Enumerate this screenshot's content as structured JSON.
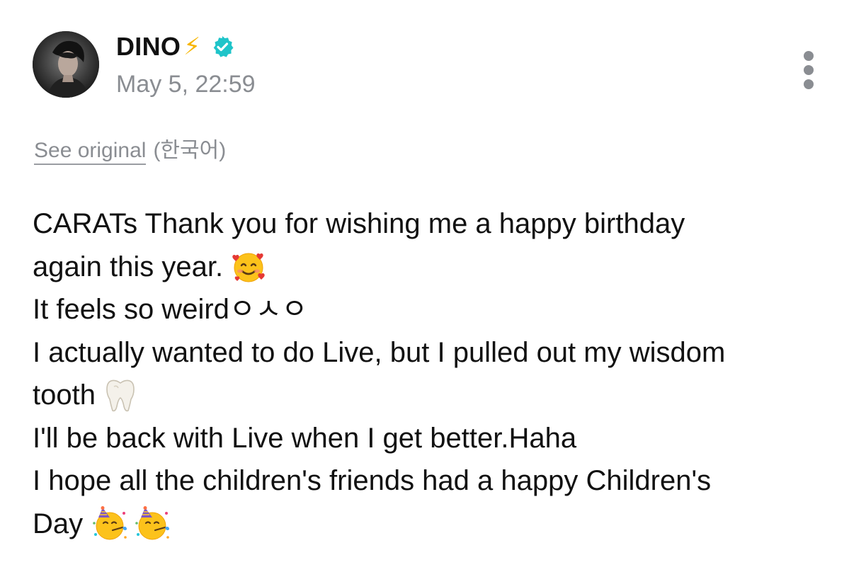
{
  "post": {
    "author": {
      "name": "DINO",
      "name_emoji": "⚡",
      "verified_icon": "verified-badge-icon",
      "avatar_icon": "avatar-photo"
    },
    "timestamp": "May 5, 22:59",
    "more_icon": "more-vertical-icon",
    "translation": {
      "see_original_label": "See original",
      "language_label": "(한국어)"
    },
    "lines": [
      {
        "text": "CARATs Thank you for wishing me a happy birthday"
      },
      {
        "text": "again this year.",
        "emoji": "smiling-face-with-hearts"
      },
      {
        "text": "It feels so weirdㅇㅅㅇ"
      },
      {
        "text": "I actually wanted to do Live, but I pulled out my wisdom"
      },
      {
        "text": "tooth",
        "emoji": "tooth"
      },
      {
        "text": "I'll be back with Live when I get better.Haha"
      },
      {
        "text": "I hope all the children's friends had a happy Children's"
      },
      {
        "text": "Day",
        "emoji": "partying-face x2"
      }
    ]
  },
  "colors": {
    "text": "#111111",
    "muted": "#8a8d92",
    "verified": "#1fc4c9",
    "bolt": "#f7b500"
  }
}
